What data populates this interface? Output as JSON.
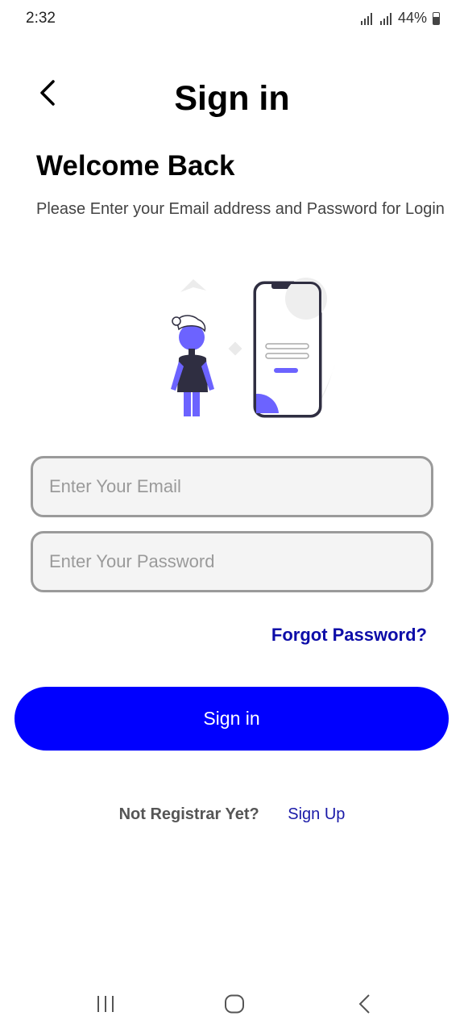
{
  "status_bar": {
    "time": "2:32",
    "battery": "44%"
  },
  "header": {
    "title": "Sign in"
  },
  "welcome": {
    "heading": "Welcome Back",
    "subtitle": "Please Enter your Email address and Password for Login"
  },
  "form": {
    "email_placeholder": "Enter Your Email",
    "password_placeholder": "Enter Your Password",
    "forgot_label": "Forgot Password?",
    "submit_label": "Sign in"
  },
  "footer": {
    "prompt": "Not Registrar Yet?",
    "signup_label": "Sign Up"
  },
  "colors": {
    "primary": "#0000ff",
    "link": "#0d0da8",
    "illustration_accent": "#6c63ff"
  }
}
